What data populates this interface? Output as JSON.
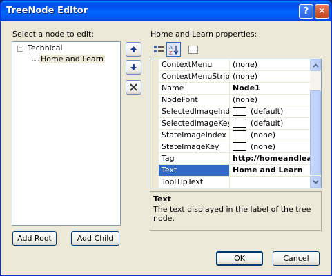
{
  "window": {
    "title": "TreeNode Editor",
    "help_glyph": "?",
    "close_glyph": "✕"
  },
  "left": {
    "label": "Select a node to edit:",
    "tree": {
      "root": {
        "expander": "−",
        "label": "Technical"
      },
      "child": {
        "label": "Home and Learn",
        "selected": true
      }
    },
    "add_root_label": "Add Root",
    "add_child_label": "Add Child"
  },
  "side_buttons": [
    "move-up",
    "move-down",
    "delete"
  ],
  "properties": {
    "label": "Home and Learn properties:",
    "toolbar": [
      "categorized",
      "alphabetical",
      "property-pages"
    ],
    "rows": [
      {
        "name": "ContextMenu",
        "value": "(none)",
        "bold": false,
        "swatch": false
      },
      {
        "name": "ContextMenuStrip",
        "value": "(none)",
        "bold": false,
        "swatch": false
      },
      {
        "name": "Name",
        "value": "Node1",
        "bold": true,
        "swatch": false
      },
      {
        "name": "NodeFont",
        "value": "(none)",
        "bold": false,
        "swatch": false
      },
      {
        "name": "SelectedImageIndex",
        "value": "(default)",
        "bold": false,
        "swatch": true
      },
      {
        "name": "SelectedImageKey",
        "value": "(default)",
        "bold": false,
        "swatch": true
      },
      {
        "name": "StateImageIndex",
        "value": "(none)",
        "bold": false,
        "swatch": true
      },
      {
        "name": "StateImageKey",
        "value": "(none)",
        "bold": false,
        "swatch": true
      },
      {
        "name": "Tag",
        "value": "http://homeandlearn",
        "bold": true,
        "swatch": false
      },
      {
        "name": "Text",
        "value": "Home and Learn",
        "bold": true,
        "swatch": false,
        "selected": true
      },
      {
        "name": "ToolTipText",
        "value": "",
        "bold": false,
        "swatch": false
      }
    ],
    "description": {
      "title": "Text",
      "text": "The text displayed in the label of the tree node."
    }
  },
  "footer": {
    "ok_label": "OK",
    "cancel_label": "Cancel"
  },
  "colors": {
    "selection": "#316ac5",
    "titlebar": "#0053ee",
    "face": "#ece9d8"
  }
}
